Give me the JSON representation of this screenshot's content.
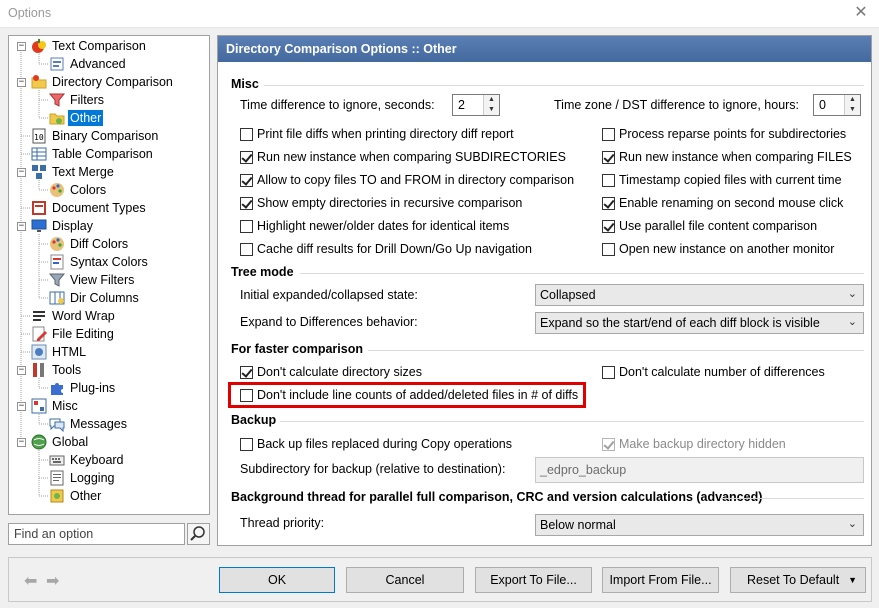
{
  "window": {
    "title": "Options"
  },
  "tree": {
    "items": [
      {
        "label": "Text Comparison",
        "level": 0
      },
      {
        "label": "Advanced",
        "level": 1
      },
      {
        "label": "Directory Comparison",
        "level": 0
      },
      {
        "label": "Filters",
        "level": 1
      },
      {
        "label": "Other",
        "level": 1,
        "selected": true
      },
      {
        "label": "Binary Comparison",
        "level": 0
      },
      {
        "label": "Table Comparison",
        "level": 0
      },
      {
        "label": "Text Merge",
        "level": 0
      },
      {
        "label": "Colors",
        "level": 1
      },
      {
        "label": "Document Types",
        "level": 0
      },
      {
        "label": "Display",
        "level": 0
      },
      {
        "label": "Diff Colors",
        "level": 1
      },
      {
        "label": "Syntax Colors",
        "level": 1
      },
      {
        "label": "View Filters",
        "level": 1
      },
      {
        "label": "Dir Columns",
        "level": 1
      },
      {
        "label": "Word Wrap",
        "level": 0
      },
      {
        "label": "File Editing",
        "level": 0
      },
      {
        "label": "HTML",
        "level": 0
      },
      {
        "label": "Tools",
        "level": 0
      },
      {
        "label": "Plug-ins",
        "level": 1
      },
      {
        "label": "Misc",
        "level": 0
      },
      {
        "label": "Messages",
        "level": 1
      },
      {
        "label": "Global",
        "level": 0
      },
      {
        "label": "Keyboard",
        "level": 1
      },
      {
        "label": "Logging",
        "level": 1
      },
      {
        "label": "Other",
        "level": 1
      }
    ],
    "search_placeholder": "Find an option"
  },
  "panel": {
    "header": "Directory Comparison Options :: Other",
    "misc": {
      "title": "Misc",
      "time_diff_label": "Time difference to ignore, seconds:",
      "time_diff_value": "2",
      "timezone_label": "Time zone / DST difference to ignore, hours:",
      "timezone_value": "0",
      "left_checks": [
        {
          "label": "Print file diffs when printing directory diff report",
          "checked": false
        },
        {
          "label": "Run new instance when comparing SUBDIRECTORIES",
          "checked": true
        },
        {
          "label": "Allow to copy files TO and FROM in directory comparison",
          "checked": true
        },
        {
          "label": "Show empty directories in recursive comparison",
          "checked": true
        },
        {
          "label": "Highlight newer/older dates for identical items",
          "checked": false
        },
        {
          "label": "Cache diff results for Drill Down/Go Up navigation",
          "checked": false
        }
      ],
      "right_checks": [
        {
          "label": "Process reparse points for subdirectories",
          "checked": false
        },
        {
          "label": "Run new instance when comparing FILES",
          "checked": true
        },
        {
          "label": "Timestamp copied files with current time",
          "checked": false
        },
        {
          "label": "Enable renaming on second mouse click",
          "checked": true
        },
        {
          "label": "Use parallel file content comparison",
          "checked": true
        },
        {
          "label": "Open new instance on another monitor",
          "checked": false
        }
      ]
    },
    "tree_mode": {
      "title": "Tree mode",
      "initial_label": "Initial expanded/collapsed state:",
      "initial_value": "Collapsed",
      "expand_label": "Expand to Differences behavior:",
      "expand_value": "Expand so the start/end of each diff block is visible"
    },
    "faster": {
      "title": "For faster comparison",
      "dir_sizes": {
        "label": "Don't calculate directory sizes",
        "checked": true
      },
      "num_diffs": {
        "label": "Don't calculate number of differences",
        "checked": false
      },
      "line_counts": {
        "label": "Don't include line counts of added/deleted files in # of diffs",
        "checked": false
      }
    },
    "backup": {
      "title": "Backup",
      "backup_files": {
        "label": "Back up files replaced during Copy operations",
        "checked": false
      },
      "hidden": {
        "label": "Make backup directory hidden",
        "checked": true
      },
      "subdir_label": "Subdirectory for backup (relative to destination):",
      "subdir_value": "_edpro_backup"
    },
    "background": {
      "title": "Background thread for parallel full comparison, CRC and version calculations (advanced)",
      "priority_label": "Thread priority:",
      "priority_value": "Below normal"
    }
  },
  "buttons": {
    "ok": "OK",
    "cancel": "Cancel",
    "export": "Export To File...",
    "import": "Import From File...",
    "reset": "Reset To Default"
  },
  "colors": {
    "header_bg": "#4e74aa",
    "selection": "#0078d7",
    "highlight_box": "#e00000"
  }
}
